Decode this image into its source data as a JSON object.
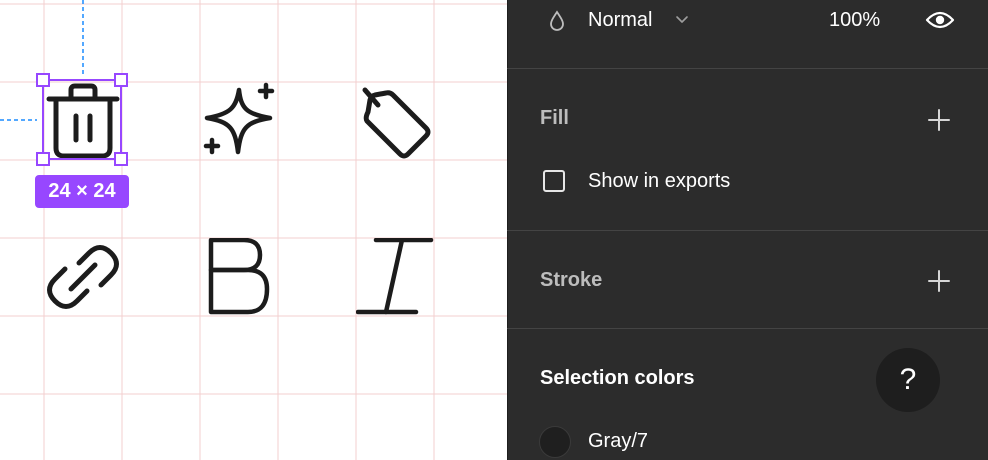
{
  "canvas": {
    "selection_size": "24 × 24",
    "icons": [
      "trash-icon",
      "sparkles-icon",
      "tag-icon",
      "link-icon",
      "bold-icon",
      "italic-icon"
    ],
    "colors": {
      "selection": "#9747ff",
      "guide": "#1a8cff",
      "grid": "#f3cfcf",
      "icon": "#1c1c1c"
    }
  },
  "panel": {
    "layer": {
      "blend_mode": "Normal",
      "opacity": "100%"
    },
    "fill": {
      "title": "Fill",
      "show_in_exports_label": "Show in exports"
    },
    "stroke": {
      "title": "Stroke"
    },
    "selection_colors": {
      "title": "Selection colors",
      "items": [
        {
          "name": "Gray/7",
          "color": "#1f1f1f"
        }
      ]
    },
    "help_label": "?"
  }
}
